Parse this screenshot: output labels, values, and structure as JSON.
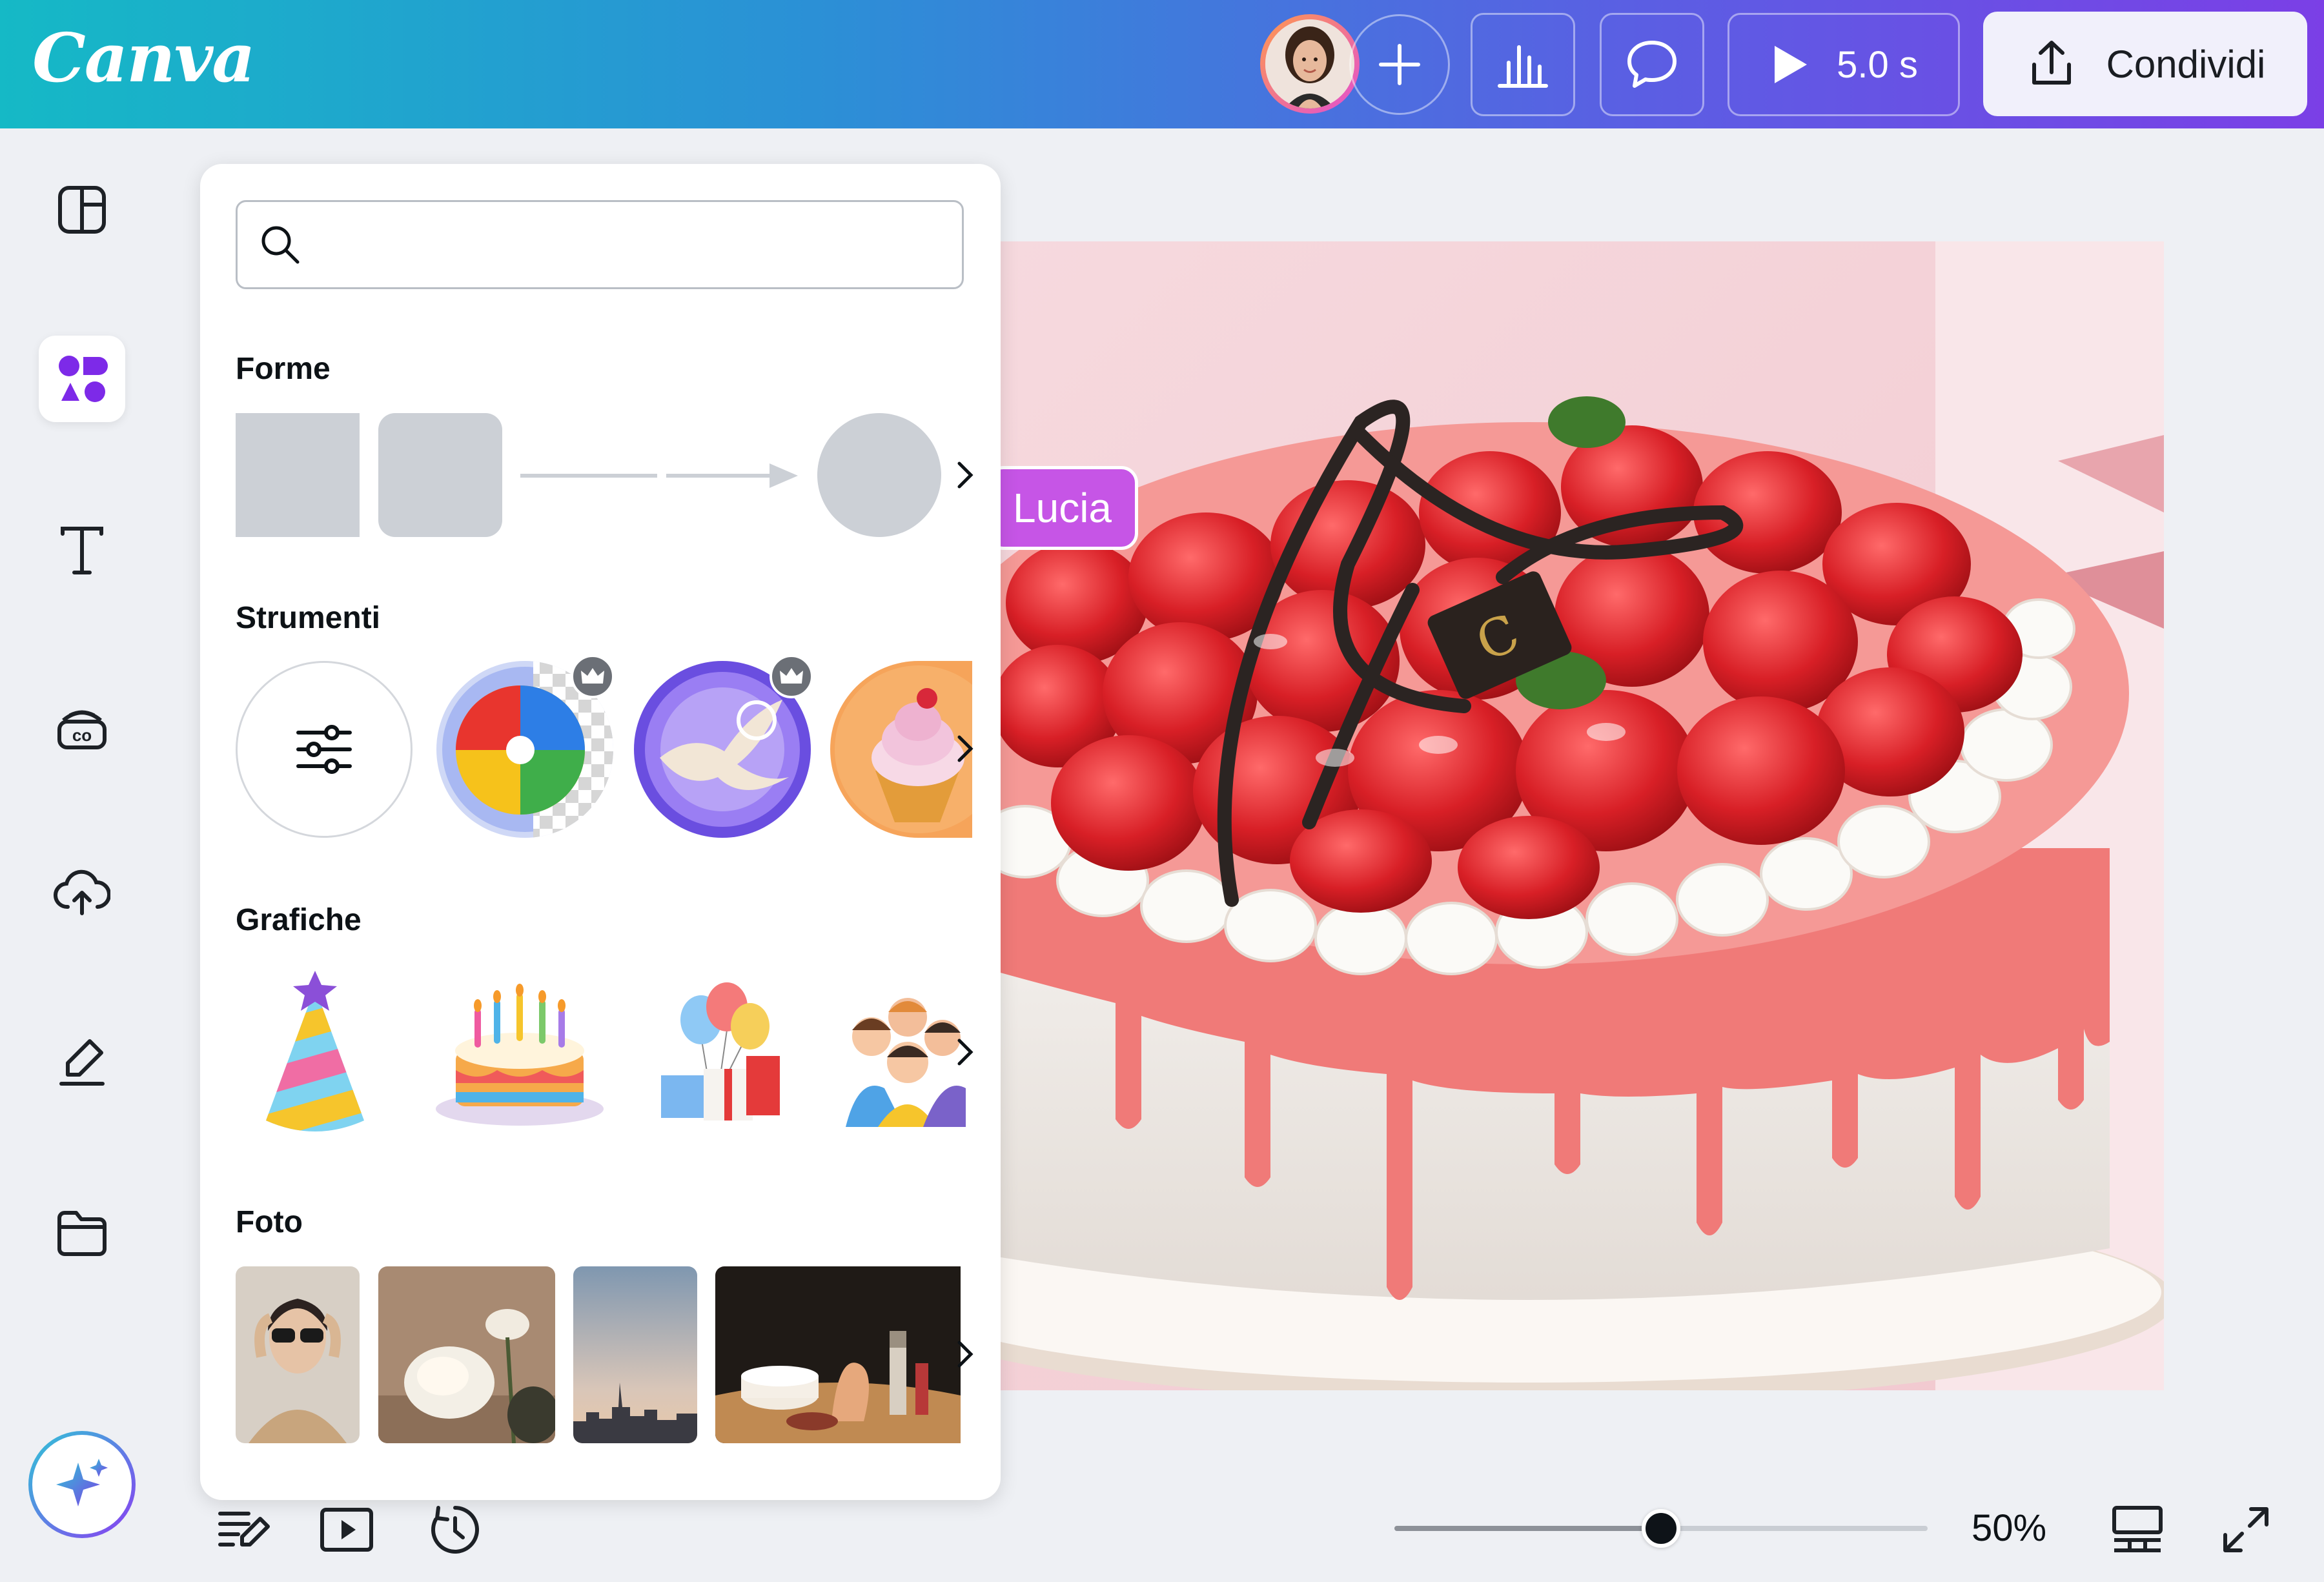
{
  "app": {
    "logo": "Canva"
  },
  "header": {
    "play_duration": "5.0 s",
    "share_label": "Condividi"
  },
  "colors": {
    "accent": "#7d2ae8",
    "collab_cursor": "#c655e6",
    "topbar_start": "#15b9c6",
    "topbar_end": "#7b3fe6"
  },
  "sidebar": {
    "items": [
      {
        "icon": "layout-icon"
      },
      {
        "icon": "elements-icon",
        "active": true
      },
      {
        "icon": "text-icon"
      },
      {
        "icon": "brand-icon"
      },
      {
        "icon": "upload-icon"
      },
      {
        "icon": "draw-icon"
      },
      {
        "icon": "folder-icon"
      }
    ],
    "magic": {
      "icon": "magic-sparkle-icon"
    }
  },
  "panel": {
    "search": {
      "placeholder": "",
      "value": ""
    },
    "sections": {
      "shapes": "Forme",
      "tools": "Strumenti",
      "graphics": "Grafiche",
      "photos": "Foto"
    }
  },
  "collaborator": {
    "name": "Lucia"
  },
  "footer": {
    "zoom": {
      "label": "50%",
      "value": 50
    }
  }
}
